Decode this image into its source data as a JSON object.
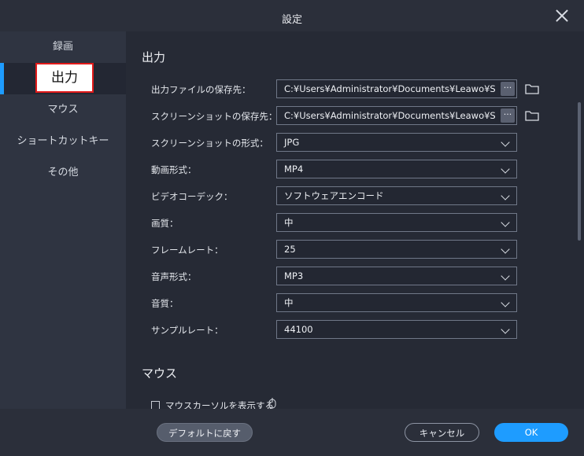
{
  "window": {
    "title": "設定"
  },
  "sidebar": {
    "items": [
      {
        "label": "録画"
      },
      {
        "label": "出力"
      },
      {
        "label": "マウス"
      },
      {
        "label": "ショートカットキー"
      },
      {
        "label": "その他"
      }
    ],
    "active_index": 1
  },
  "output": {
    "section_title": "出力",
    "rows": [
      {
        "label": "出力ファイルの保存先：",
        "value": "C:¥Users¥Administrator¥Documents¥Leawo¥S",
        "type": "path"
      },
      {
        "label": "スクリーンショットの保存先：",
        "value": "C:¥Users¥Administrator¥Documents¥Leawo¥S",
        "type": "path"
      },
      {
        "label": "スクリーンショットの形式：",
        "value": "JPG",
        "type": "select"
      },
      {
        "label": "動画形式：",
        "value": "MP4",
        "type": "select"
      },
      {
        "label": "ビデオコーデック：",
        "value": "ソフトウェアエンコード",
        "type": "select"
      },
      {
        "label": "画質：",
        "value": "中",
        "type": "select"
      },
      {
        "label": "フレームレート：",
        "value": "25",
        "type": "select"
      },
      {
        "label": "音声形式：",
        "value": "MP3",
        "type": "select"
      },
      {
        "label": "音質：",
        "value": "中",
        "type": "select"
      },
      {
        "label": "サンプルレート：",
        "value": "44100",
        "type": "select"
      }
    ],
    "browse_button_label": "···"
  },
  "mouse": {
    "section_title": "マウス",
    "show_cursor_label": "マウスカーソルを表示する",
    "show_cursor_checked": false
  },
  "footer": {
    "default_label": "デフォルトに戻す",
    "cancel_label": "キャンセル",
    "ok_label": "OK"
  },
  "colors": {
    "accent": "#1e9cff",
    "highlight": "#e21a1a"
  }
}
